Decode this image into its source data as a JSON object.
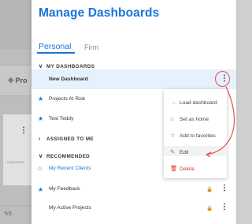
{
  "background": {
    "partial_label": "Pro",
    "kebab": "⋮",
    "small_label": "UNNAMED",
    "count": "5"
  },
  "panel": {
    "title": "Manage Dashboards",
    "tabs": [
      "Personal",
      "Firm"
    ]
  },
  "sections": {
    "my": "MY DASHBOARDS",
    "assigned": "ASSIGNED TO ME",
    "recommended": "RECOMMENDED"
  },
  "my_dashboards": [
    "New Dashboard",
    "Projects At Risk",
    "Test Teddy"
  ],
  "recommended": [
    "My Recent Clients",
    "My Feedback",
    "My Active Projects"
  ],
  "menu": {
    "items": [
      "Load dashboard",
      "Set as home",
      "Add to favorites",
      "Edit",
      "Delete"
    ]
  },
  "icons": {
    "kebab": "⋮",
    "star": "★",
    "home": "⌂",
    "lock": "🔒"
  },
  "colors": {
    "accent": "#1b74d6",
    "highlight": "#e5f1fc",
    "annotation": "#e54d4d",
    "delete": "#e03030"
  }
}
